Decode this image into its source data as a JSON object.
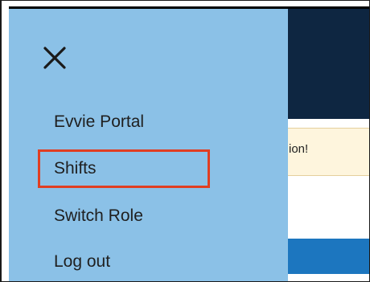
{
  "background_page": {
    "alert_text": "ion!"
  },
  "drawer": {
    "close_icon": "close-icon",
    "items": [
      {
        "label": "Evvie Portal"
      },
      {
        "label": "Shifts",
        "highlighted": true
      },
      {
        "label": "Switch Role"
      },
      {
        "label": "Log out"
      }
    ]
  },
  "colors": {
    "drawer_bg": "#8bc1e7",
    "header_bg": "#0e2641",
    "alert_bg": "#fef5dd",
    "primary_button": "#1c76bf",
    "highlight": "#e03e22"
  }
}
